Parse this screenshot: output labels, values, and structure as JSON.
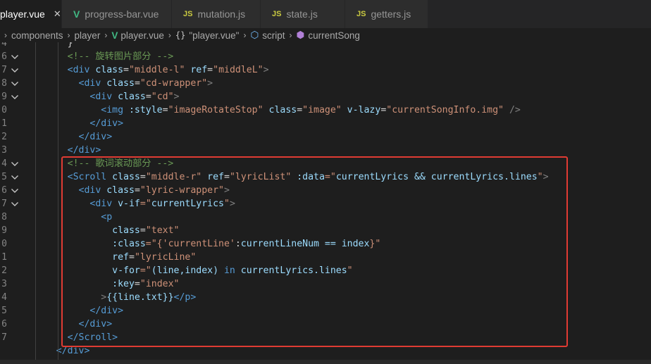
{
  "tabs": [
    {
      "label": "player.vue",
      "icon": "vue-icon",
      "active": true
    },
    {
      "label": "progress-bar.vue",
      "icon": "vue-icon",
      "active": false
    },
    {
      "label": "mutation.js",
      "icon": "js-icon",
      "active": false
    },
    {
      "label": "state.js",
      "icon": "js-icon",
      "active": false
    },
    {
      "label": "getters.js",
      "icon": "js-icon",
      "active": false
    }
  ],
  "breadcrumb": [
    "components",
    "player",
    "player.vue",
    "\"player.vue\"",
    "script",
    "currentSong"
  ],
  "line_numbers": [
    "4",
    "6",
    "7",
    "8",
    "9",
    "0",
    "1",
    "2",
    "3",
    "4",
    "5",
    "6",
    "7",
    "8",
    "9",
    "0",
    "1",
    "2",
    "3",
    "4",
    "5",
    "6",
    "7"
  ],
  "code_lines": [
    [
      {
        "t": "      ",
        "c": ""
      },
      {
        "t": "}",
        "c": "t-op"
      }
    ],
    [
      {
        "t": "      ",
        "c": ""
      },
      {
        "t": "<!-- 旋转图片部分 -->",
        "c": "t-cm"
      }
    ],
    [
      {
        "t": "      ",
        "c": ""
      },
      {
        "t": "<div",
        "c": "t-tag"
      },
      {
        "t": " class",
        "c": "t-attr"
      },
      {
        "t": "=",
        "c": "t-eq"
      },
      {
        "t": "\"middle-l\"",
        "c": "t-str"
      },
      {
        "t": " ref",
        "c": "t-attr"
      },
      {
        "t": "=",
        "c": "t-eq"
      },
      {
        "t": "\"middleL\"",
        "c": "t-str"
      },
      {
        "t": ">",
        "c": "t-p"
      }
    ],
    [
      {
        "t": "        ",
        "c": ""
      },
      {
        "t": "<div",
        "c": "t-tag"
      },
      {
        "t": " class",
        "c": "t-attr"
      },
      {
        "t": "=",
        "c": "t-eq"
      },
      {
        "t": "\"cd-wrapper\"",
        "c": "t-str"
      },
      {
        "t": ">",
        "c": "t-p"
      }
    ],
    [
      {
        "t": "          ",
        "c": ""
      },
      {
        "t": "<div",
        "c": "t-tag"
      },
      {
        "t": " class",
        "c": "t-attr"
      },
      {
        "t": "=",
        "c": "t-eq"
      },
      {
        "t": "\"cd\"",
        "c": "t-str"
      },
      {
        "t": ">",
        "c": "t-p"
      }
    ],
    [
      {
        "t": "            ",
        "c": ""
      },
      {
        "t": "<img",
        "c": "t-tag"
      },
      {
        "t": " :style",
        "c": "t-attr"
      },
      {
        "t": "=",
        "c": "t-eq"
      },
      {
        "t": "\"imageRotateStop\"",
        "c": "t-str"
      },
      {
        "t": " class",
        "c": "t-attr"
      },
      {
        "t": "=",
        "c": "t-eq"
      },
      {
        "t": "\"image\"",
        "c": "t-str"
      },
      {
        "t": " v-lazy",
        "c": "t-attr"
      },
      {
        "t": "=",
        "c": "t-eq"
      },
      {
        "t": "\"currentSongInfo.img\"",
        "c": "t-str"
      },
      {
        "t": " />",
        "c": "t-p"
      }
    ],
    [
      {
        "t": "          ",
        "c": ""
      },
      {
        "t": "</div>",
        "c": "t-tag"
      }
    ],
    [
      {
        "t": "        ",
        "c": ""
      },
      {
        "t": "</div>",
        "c": "t-tag"
      }
    ],
    [
      {
        "t": "      ",
        "c": ""
      },
      {
        "t": "</div>",
        "c": "t-tag"
      }
    ],
    [
      {
        "t": "      ",
        "c": ""
      },
      {
        "t": "<!-- 歌词滚动部分 -->",
        "c": "t-cm"
      }
    ],
    [
      {
        "t": "      ",
        "c": ""
      },
      {
        "t": "<Scroll",
        "c": "t-tag"
      },
      {
        "t": " class",
        "c": "t-attr"
      },
      {
        "t": "=",
        "c": "t-eq"
      },
      {
        "t": "\"middle-r\"",
        "c": "t-str"
      },
      {
        "t": " ref",
        "c": "t-attr"
      },
      {
        "t": "=",
        "c": "t-eq"
      },
      {
        "t": "\"lyricList\"",
        "c": "t-str"
      },
      {
        "t": " :data",
        "c": "t-attr"
      },
      {
        "t": "=\"",
        "c": "t-str"
      },
      {
        "t": "currentLyrics && currentLyrics.lines",
        "c": "t-attr"
      },
      {
        "t": "\"",
        "c": "t-str"
      },
      {
        "t": ">",
        "c": "t-p"
      }
    ],
    [
      {
        "t": "        ",
        "c": ""
      },
      {
        "t": "<div",
        "c": "t-tag"
      },
      {
        "t": " class",
        "c": "t-attr"
      },
      {
        "t": "=",
        "c": "t-eq"
      },
      {
        "t": "\"lyric-wrapper\"",
        "c": "t-str"
      },
      {
        "t": ">",
        "c": "t-p"
      }
    ],
    [
      {
        "t": "          ",
        "c": ""
      },
      {
        "t": "<div",
        "c": "t-tag"
      },
      {
        "t": " v-if",
        "c": "t-attr"
      },
      {
        "t": "=\"",
        "c": "t-str"
      },
      {
        "t": "currentLyrics",
        "c": "t-attr"
      },
      {
        "t": "\"",
        "c": "t-str"
      },
      {
        "t": ">",
        "c": "t-p"
      }
    ],
    [
      {
        "t": "            ",
        "c": ""
      },
      {
        "t": "<p",
        "c": "t-tag"
      }
    ],
    [
      {
        "t": "              ",
        "c": ""
      },
      {
        "t": "class",
        "c": "t-attr"
      },
      {
        "t": "=",
        "c": "t-eq"
      },
      {
        "t": "\"text\"",
        "c": "t-str"
      }
    ],
    [
      {
        "t": "              ",
        "c": ""
      },
      {
        "t": ":class",
        "c": "t-attr"
      },
      {
        "t": "=\"{",
        "c": "t-str"
      },
      {
        "t": "'currentLine'",
        "c": "t-str"
      },
      {
        "t": ":",
        "c": "t-op"
      },
      {
        "t": "currentLineNum == index",
        "c": "t-attr"
      },
      {
        "t": "}\"",
        "c": "t-str"
      }
    ],
    [
      {
        "t": "              ",
        "c": ""
      },
      {
        "t": "ref",
        "c": "t-attr"
      },
      {
        "t": "=",
        "c": "t-eq"
      },
      {
        "t": "\"lyricLine\"",
        "c": "t-str"
      }
    ],
    [
      {
        "t": "              ",
        "c": ""
      },
      {
        "t": "v-for",
        "c": "t-attr"
      },
      {
        "t": "=\"",
        "c": "t-str"
      },
      {
        "t": "(line,index) ",
        "c": "t-attr"
      },
      {
        "t": "in",
        "c": "t-kw"
      },
      {
        "t": " currentLyrics.lines",
        "c": "t-attr"
      },
      {
        "t": "\"",
        "c": "t-str"
      }
    ],
    [
      {
        "t": "              ",
        "c": ""
      },
      {
        "t": ":key",
        "c": "t-attr"
      },
      {
        "t": "=",
        "c": "t-eq"
      },
      {
        "t": "\"index\"",
        "c": "t-str"
      }
    ],
    [
      {
        "t": "            ",
        "c": ""
      },
      {
        "t": ">",
        "c": "t-p"
      },
      {
        "t": "{{line.txt}}",
        "c": "t-attr"
      },
      {
        "t": "</p>",
        "c": "t-tag"
      }
    ],
    [
      {
        "t": "          ",
        "c": ""
      },
      {
        "t": "</div>",
        "c": "t-tag"
      }
    ],
    [
      {
        "t": "        ",
        "c": ""
      },
      {
        "t": "</div>",
        "c": "t-tag"
      }
    ],
    [
      {
        "t": "      ",
        "c": ""
      },
      {
        "t": "</Scroll>",
        "c": "t-tag"
      }
    ],
    [
      {
        "t": "    ",
        "c": ""
      },
      {
        "t": "</div>",
        "c": "t-tag"
      }
    ]
  ],
  "folded_lines": [
    1,
    2,
    3,
    4,
    9,
    10,
    11,
    12
  ],
  "colors": {
    "highlight_border": "#e03b33",
    "vue": "#41b883",
    "js": "#cbcb41"
  }
}
